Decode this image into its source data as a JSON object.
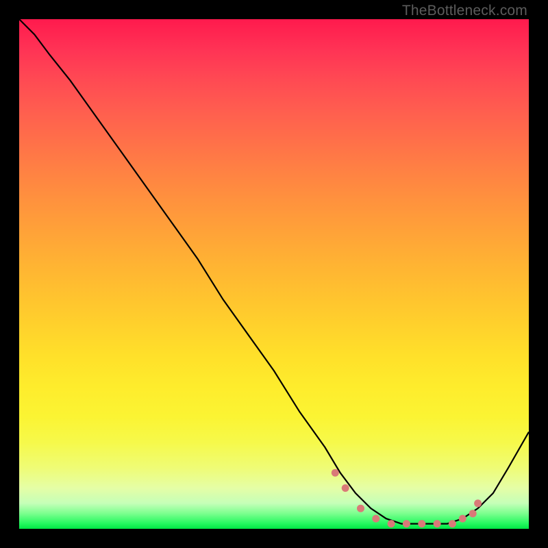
{
  "watermark": "TheBottleneck.com",
  "chart_data": {
    "type": "line",
    "title": "",
    "xlabel": "",
    "ylabel": "",
    "xlim": [
      0,
      100
    ],
    "ylim": [
      0,
      100
    ],
    "grid": false,
    "series": [
      {
        "name": "bottleneck-curve",
        "color": "#000000",
        "x": [
          0,
          3,
          6,
          10,
          15,
          20,
          25,
          30,
          35,
          40,
          45,
          50,
          55,
          60,
          63,
          66,
          69,
          72,
          75,
          78,
          81,
          84,
          87,
          90,
          93,
          96,
          100
        ],
        "values": [
          100,
          97,
          93,
          88,
          81,
          74,
          67,
          60,
          53,
          45,
          38,
          31,
          23,
          16,
          11,
          7,
          4,
          2,
          1,
          1,
          1,
          1,
          2,
          4,
          7,
          12,
          19
        ]
      }
    ],
    "markers": {
      "name": "highlight-dots",
      "color": "#d97a78",
      "x": [
        62,
        64,
        67,
        70,
        73,
        76,
        79,
        82,
        85,
        87,
        89,
        90
      ],
      "values": [
        11,
        8,
        4,
        2,
        1,
        1,
        1,
        1,
        1,
        2,
        3,
        5
      ]
    }
  }
}
